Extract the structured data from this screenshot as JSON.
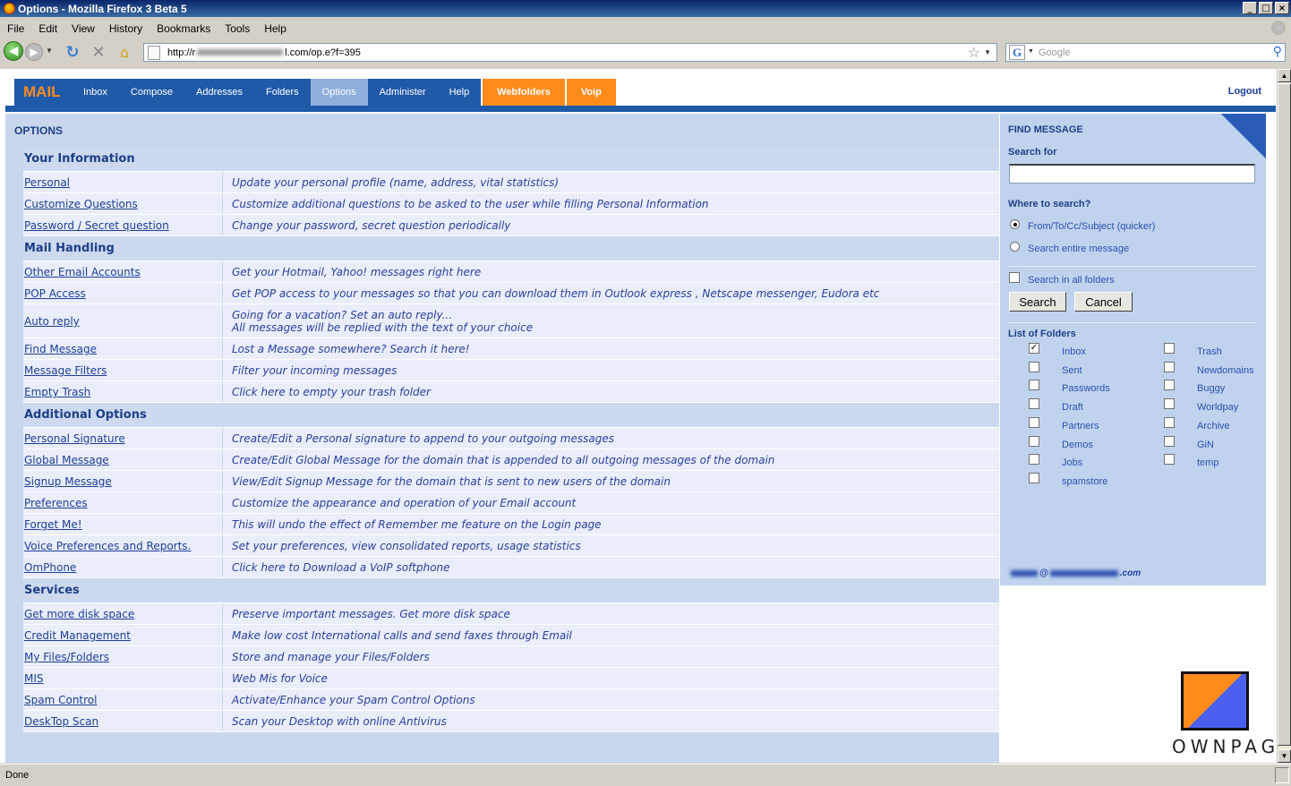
{
  "window": {
    "title": "Options - Mozilla Firefox 3 Beta 5"
  },
  "menu": [
    "File",
    "Edit",
    "View",
    "History",
    "Bookmarks",
    "Tools",
    "Help"
  ],
  "address": {
    "prefix": "http://r",
    "suffix": "l.com/op.e?f=395"
  },
  "search_engine": {
    "placeholder": "Google"
  },
  "app": {
    "logo": "MAIL",
    "tabs": [
      "Inbox",
      "Compose",
      "Addresses",
      "Folders",
      "Options",
      "Administer",
      "Help"
    ],
    "active_tab": "Options",
    "special_tabs": [
      "Webfolders",
      "Voip"
    ],
    "logout": "Logout"
  },
  "options": {
    "heading": "OPTIONS",
    "sections": [
      {
        "title": "Your Information",
        "rows": [
          {
            "link": "Personal",
            "desc": "Update your personal profile (name, address, vital statistics)"
          },
          {
            "link": "Customize Questions",
            "desc": "Customize additional questions to be asked to the user while filling Personal Information"
          },
          {
            "link": "Password / Secret question",
            "desc": "Change your password, secret question periodically"
          }
        ]
      },
      {
        "title": "Mail Handling",
        "rows": [
          {
            "link": "Other Email Accounts",
            "desc": "Get your Hotmail, Yahoo! messages right here"
          },
          {
            "link": "POP Access",
            "desc": "Get POP access to your messages so that you can download them in Outlook express , Netscape messenger, Eudora etc"
          },
          {
            "link": "Auto reply",
            "desc": "Going for a vacation? Set an auto reply...",
            "desc2": "All messages will be replied with the text of your choice"
          },
          {
            "link": "Find Message",
            "desc": "Lost a Message somewhere? Search it here!"
          },
          {
            "link": "Message Filters",
            "desc": "Filter your incoming messages"
          },
          {
            "link": "Empty Trash",
            "desc": "Click here to empty your trash folder"
          }
        ]
      },
      {
        "title": "Additional Options",
        "rows": [
          {
            "link": "Personal Signature",
            "desc": "Create/Edit a Personal signature to append to your outgoing messages"
          },
          {
            "link": "Global Message",
            "desc": "Create/Edit Global Message for the domain that is appended to all outgoing messages of the domain"
          },
          {
            "link": "Signup Message",
            "desc": "View/Edit Signup Message for the domain that is sent to new users of the domain"
          },
          {
            "link": "Preferences",
            "desc": "Customize the appearance and operation of your Email account"
          },
          {
            "link": "Forget Me!",
            "desc": "This will undo the effect of Remember me feature on the Login page"
          },
          {
            "link": "Voice Preferences and Reports.",
            "desc": "Set your preferences, view consolidated reports, usage statistics"
          },
          {
            "link": "OmPhone",
            "desc": "Click here to Download a VoIP softphone"
          }
        ]
      },
      {
        "title": "Services",
        "rows": [
          {
            "link": "Get more disk space",
            "desc": "Preserve important messages. Get more disk space"
          },
          {
            "link": "Credit Management",
            "desc": "Make low cost International calls and send faxes through Email"
          },
          {
            "link": "My Files/Folders",
            "desc": "Store and manage your Files/Folders"
          },
          {
            "link": "MIS",
            "desc": "Web Mis for Voice"
          },
          {
            "link": "Spam Control",
            "desc": "Activate/Enhance your Spam Control Options"
          },
          {
            "link": "DeskTop Scan",
            "desc": "Scan your Desktop with online Antivirus"
          }
        ]
      }
    ]
  },
  "find": {
    "heading": "FIND MESSAGE",
    "search_for": "Search for",
    "search_value": "",
    "where": "Where to search?",
    "opt_quick": "From/To/Cc/Subject (quicker)",
    "opt_entire": "Search entire message",
    "all_folders": "Search in all folders",
    "search_btn": "Search",
    "cancel_btn": "Cancel",
    "folders_heading": "List of Folders",
    "folders_left": [
      "Inbox",
      "Sent",
      "Passwords",
      "Draft",
      "Partners",
      "Demos",
      "Jobs",
      "spamstore"
    ],
    "folders_right": [
      "Trash",
      "Newdomains",
      "Buggy",
      "Worldpay",
      "Archive",
      "GiN",
      "temp"
    ],
    "checked": [
      "Inbox"
    ],
    "email_at": "@",
    "email_tail": ".com"
  },
  "brand": {
    "name": "OWNPAGES"
  },
  "statusbar": {
    "text": "Done"
  }
}
